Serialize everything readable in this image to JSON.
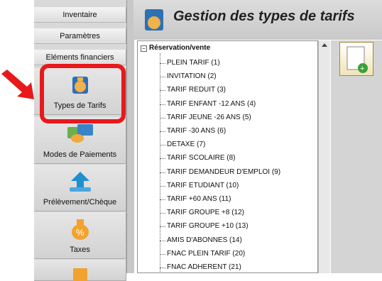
{
  "nav": {
    "tabs": [
      "Inventaire",
      "Paramètres",
      "Eléments financiers"
    ],
    "buttons": [
      {
        "label": "Types de Tarifs",
        "icon": "money-bag-icon"
      },
      {
        "label": "Modes de Paiements",
        "icon": "payment-cards-icon"
      },
      {
        "label": "Prélèvement/Chèque",
        "icon": "upload-arrow-icon"
      },
      {
        "label": "Taxes",
        "icon": "percent-bag-icon"
      },
      {
        "label": "",
        "icon": "pound-note-icon"
      }
    ]
  },
  "header": {
    "title": "Gestion des types de tarifs"
  },
  "tree": {
    "root": "Réservation/vente",
    "items": [
      "PLEIN TARIF (1)",
      "INVITATION (2)",
      "TARIF REDUIT (3)",
      "TARIF ENFANT -12 ANS (4)",
      "TARIF JEUNE -26 ANS (5)",
      "TARIF -30 ANS (6)",
      "DETAXE (7)",
      "TARIF SCOLAIRE (8)",
      "TARIF DEMANDEUR D'EMPLOI (9)",
      "TARIF ETUDIANT (10)",
      "TARIF +60 ANS (11)",
      "TARIF GROUPE +8 (12)",
      "TARIF GROUPE +10 (13)",
      "AMIS D'ABONNES (14)",
      "FNAC PLEIN TARIF (20)",
      "FNAC ADHERENT (21)"
    ]
  },
  "colors": {
    "highlight": "#e8191b",
    "arrow": "#e8191b"
  }
}
